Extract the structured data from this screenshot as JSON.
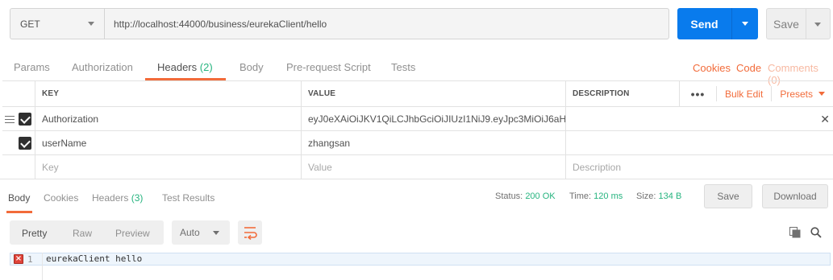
{
  "request": {
    "method": "GET",
    "url": "http://localhost:44000/business/eurekaClient/hello",
    "send_label": "Send",
    "save_label": "Save"
  },
  "tabs": [
    {
      "label": "Params"
    },
    {
      "label": "Authorization"
    },
    {
      "label": "Headers",
      "count": "(2)"
    },
    {
      "label": "Body"
    },
    {
      "label": "Pre-request Script"
    },
    {
      "label": "Tests"
    }
  ],
  "right_links": {
    "cookies": "Cookies",
    "code": "Code",
    "comments": "Comments (0)"
  },
  "headers_table": {
    "columns": [
      "KEY",
      "VALUE",
      "DESCRIPTION"
    ],
    "bulk_edit": "Bulk Edit",
    "presets": "Presets",
    "more": "•••",
    "rows": [
      {
        "key": "Authorization",
        "value": "eyJ0eXAiOiJKV1QiLCJhbGciOiJIUzI1NiJ9.eyJpc3MiOiJ6aH...",
        "description": ""
      },
      {
        "key": "userName",
        "value": "zhangsan",
        "description": ""
      }
    ],
    "placeholders": {
      "key": "Key",
      "value": "Value",
      "description": "Description"
    }
  },
  "response": {
    "tabs": [
      {
        "label": "Body"
      },
      {
        "label": "Cookies"
      },
      {
        "label": "Headers",
        "count": "(3)"
      },
      {
        "label": "Test Results"
      }
    ],
    "status_label": "Status:",
    "status": "200 OK",
    "time_label": "Time:",
    "time": "120 ms",
    "size_label": "Size:",
    "size": "134 B",
    "save_label": "Save",
    "download_label": "Download"
  },
  "view": {
    "modes": [
      "Pretty",
      "Raw",
      "Preview"
    ],
    "format": "Auto"
  },
  "body": {
    "line_number": "1",
    "text": "eurekaClient hello"
  },
  "colors": {
    "accent": "#f26b3a",
    "send": "#097bed",
    "success": "#26b47f"
  }
}
